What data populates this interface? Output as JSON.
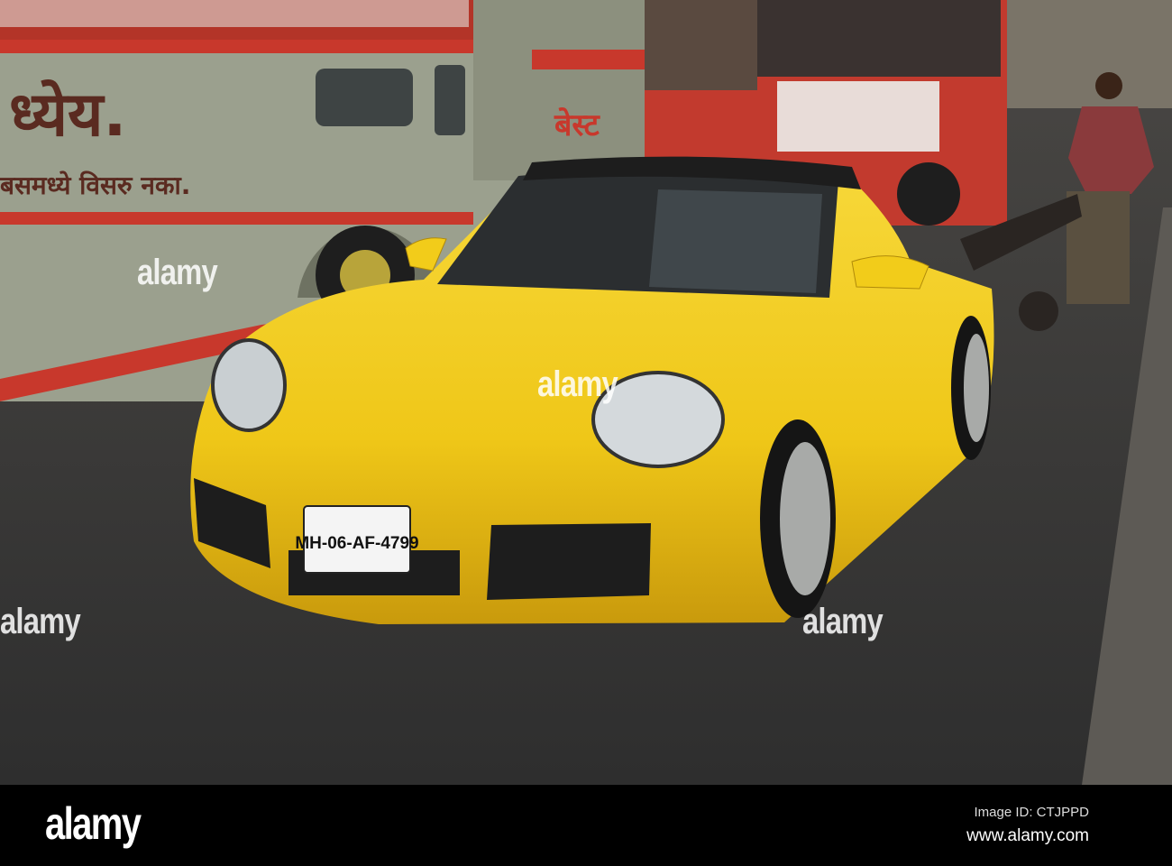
{
  "photo": {
    "bus_sign_large": "ध्येय.",
    "bus_sign_small": "बसमध्ये विसरु नका.",
    "bus_brand": "बेस्ट",
    "license_plate": "MH-06-AF-4799"
  },
  "watermark": {
    "text": "alamy",
    "letter": "a"
  },
  "footer": {
    "logo": "alamy",
    "image_id": "Image ID: CTJPPD",
    "website": "www.alamy.com"
  },
  "colors": {
    "car_yellow": "#f2cc1a",
    "bus_grey": "#9aa08c",
    "bus_red": "#c8382c",
    "road": "#3b3b3b"
  }
}
